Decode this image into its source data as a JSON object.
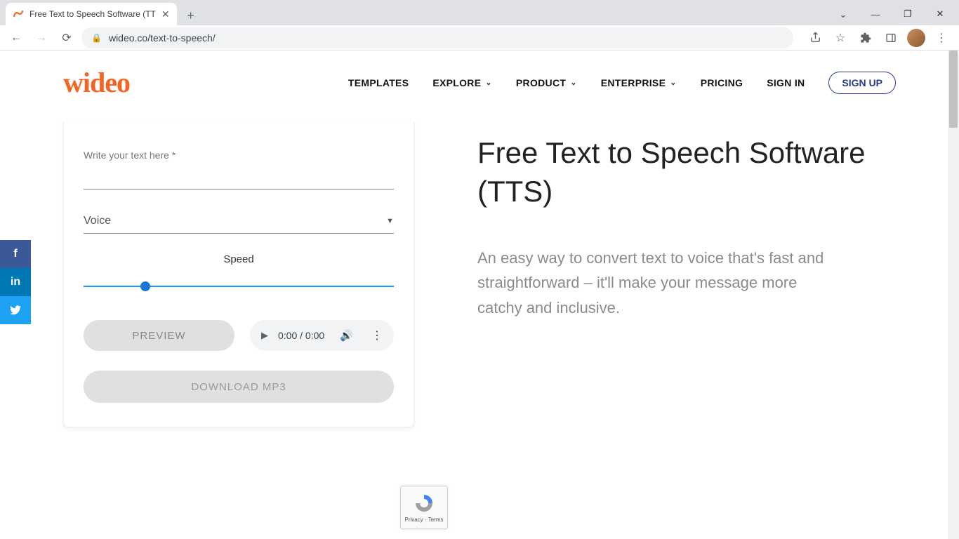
{
  "browser": {
    "tab_title": "Free Text to Speech Software (TT",
    "url": "wideo.co/text-to-speech/"
  },
  "nav": {
    "logo": "wideo",
    "templates": "TEMPLATES",
    "explore": "EXPLORE",
    "product": "PRODUCT",
    "enterprise": "ENTERPRISE",
    "pricing": "PRICING",
    "signin": "SIGN IN",
    "signup": "SIGN UP"
  },
  "tts": {
    "write_label": "Write your text here *",
    "voice_label": "Voice",
    "speed_label": "Speed",
    "preview": "PREVIEW",
    "audio_time": "0:00 / 0:00",
    "download": "DOWNLOAD MP3"
  },
  "hero": {
    "title": "Free Text to Speech Software (TTS)",
    "subtitle": "An easy way to convert text to voice that's fast and straightforward – it'll make your message more catchy and inclusive."
  },
  "recaptcha": {
    "text": "Privacy · Terms"
  }
}
